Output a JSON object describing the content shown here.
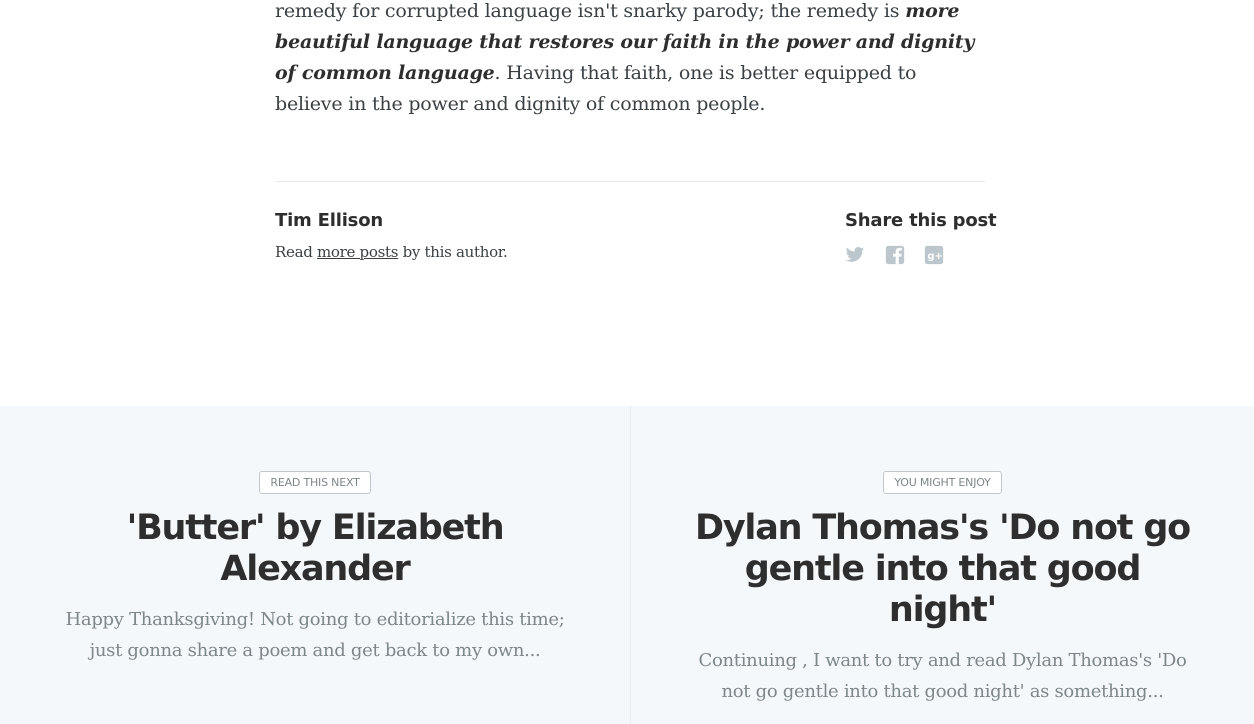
{
  "article": {
    "text_before": "remedy for corrupted language isn't snarky parody; the remedy is ",
    "emphasis": "more beautiful language that restores our faith in the power and dignity of common language",
    "text_after": ". Having that faith, one is better equipped to believe in the power and dignity of common people."
  },
  "author": {
    "name": "Tim Ellison",
    "read_prefix": "Read ",
    "more_posts_link": "more posts",
    "read_suffix": " by this author."
  },
  "share": {
    "title": "Share this post",
    "icons": [
      "twitter-icon",
      "facebook-icon",
      "google-plus-icon"
    ],
    "icon_color": "#bbc7cc"
  },
  "read_next": {
    "background": "#f5f8fa",
    "next": {
      "badge": "READ THIS NEXT",
      "title": "'Butter' by Elizabeth Alexander",
      "excerpt": "Happy Thanksgiving! Not going to editorialize this time; just gonna share a poem and get back to my own..."
    },
    "prev": {
      "badge": "YOU MIGHT ENJOY",
      "title": "Dylan Thomas's 'Do not go gentle into that good night'",
      "excerpt": "Continuing , I want to try and read Dylan Thomas's 'Do not go gentle into that good night' as something..."
    }
  }
}
